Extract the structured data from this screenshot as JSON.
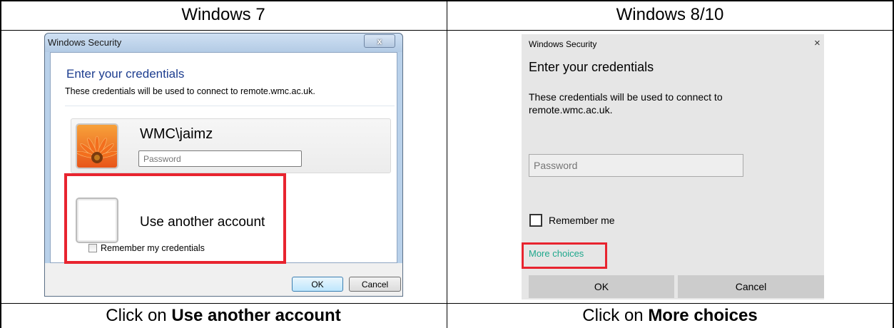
{
  "table": {
    "headers": [
      "Windows 7",
      "Windows 8/10"
    ],
    "captions": [
      {
        "prefix": "Click on ",
        "bold": "Use another account"
      },
      {
        "prefix": "Click on ",
        "bold": "More choices"
      }
    ]
  },
  "win7": {
    "window_title": "Windows Security",
    "close_glyph": "x",
    "heading": "Enter your credentials",
    "description": "These credentials will be used to connect to remote.wmc.ac.uk.",
    "username": "WMC\\jaimz",
    "password_placeholder": "Password",
    "other_account_label": "Use another account",
    "remember_label": "Remember my credentials",
    "ok_label": "OK",
    "cancel_label": "Cancel",
    "highlight_color": "#e8242f"
  },
  "win10": {
    "window_title": "Windows Security",
    "close_glyph": "×",
    "heading": "Enter your credentials",
    "description": "These credentials will be used to connect to remote.wmc.ac.uk.",
    "password_placeholder": "Password",
    "remember_label": "Remember me",
    "more_choices_label": "More choices",
    "ok_label": "OK",
    "cancel_label": "Cancel",
    "link_color": "#1ea78c"
  }
}
